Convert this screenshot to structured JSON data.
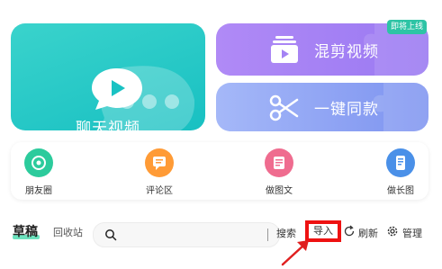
{
  "cards": {
    "chat_video": {
      "label": "聊天视频",
      "icon": "chat-play-icon"
    },
    "mix_video": {
      "label": "混剪视频",
      "icon": "video-stack-icon"
    },
    "one_click": {
      "label": "一键同款",
      "icon": "scissors-icon"
    },
    "badge": "即将上线"
  },
  "features": [
    {
      "label": "朋友圈",
      "icon": "aperture-icon",
      "color": "#2ccb9c"
    },
    {
      "label": "评论区",
      "icon": "comment-icon",
      "color": "#ff9b36"
    },
    {
      "label": "做图文",
      "icon": "image-text-icon",
      "color": "#ef6c8f"
    },
    {
      "label": "做长图",
      "icon": "long-image-icon",
      "color": "#4a90e8"
    }
  ],
  "toolbar": {
    "draft_tab": "草稿",
    "trash_tab": "回收站",
    "search_placeholder": "",
    "search_button": "搜索",
    "import_button": "导入",
    "refresh_button": "刷新",
    "manage_button": "管理"
  },
  "colors": {
    "chat_card": "#22c6c4",
    "mix_card": "#a482f4",
    "one_click_card": "#8fa4f4",
    "badge": "#2dc4a5",
    "highlight": "#ee1111",
    "draft_underline": "#2ed6a2"
  }
}
